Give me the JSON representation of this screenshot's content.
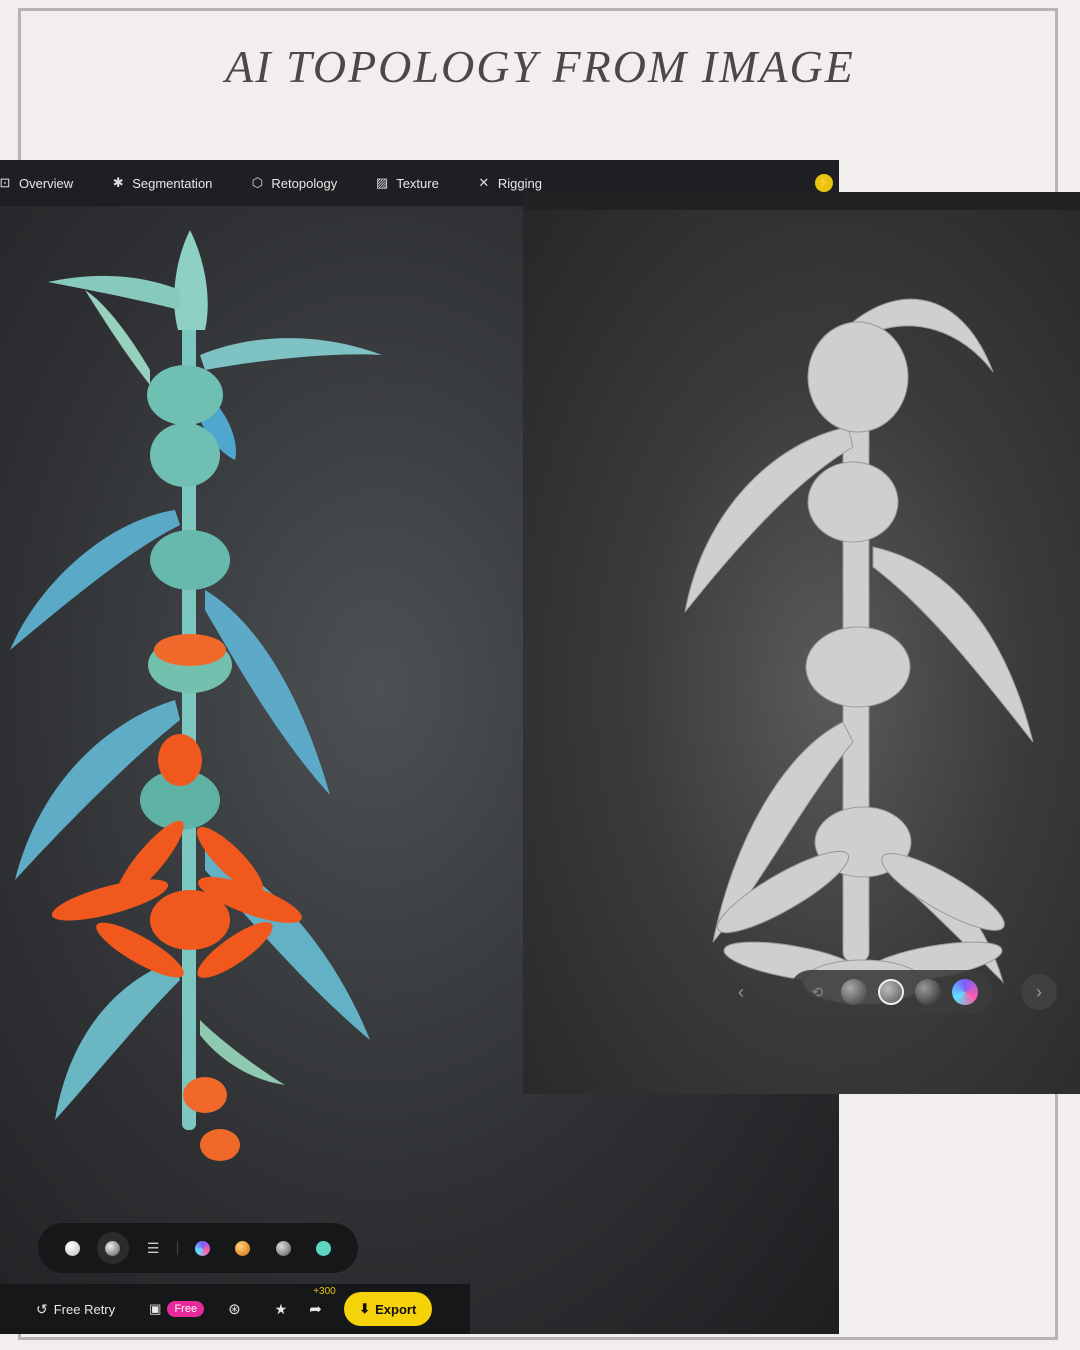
{
  "headline": "AI TOPOLOGY FROM IMAGE",
  "tabs": [
    {
      "label": "Overview",
      "icon": "overview-icon"
    },
    {
      "label": "Segmentation",
      "icon": "puzzle-icon"
    },
    {
      "label": "Retopology",
      "icon": "cube-mesh-icon"
    },
    {
      "label": "Texture",
      "icon": "texture-icon"
    },
    {
      "label": "Rigging",
      "icon": "figure-icon"
    }
  ],
  "material_bar": {
    "swatches": [
      "#e6e6e6",
      "#9a9a9a",
      "sliders-icon",
      "gradient-blue-pink",
      "#e8891f",
      "#888888",
      "#5fd6c4"
    ]
  },
  "actions": {
    "retry_label": "Free Retry",
    "free_badge": "Free",
    "bonus": "+300",
    "export_label": "Export"
  },
  "colors": {
    "accent_yellow": "#f5d20a",
    "free_pink": "#e8299b",
    "plant_teal": "#6fc2bd",
    "flower_orange": "#f0581d"
  }
}
